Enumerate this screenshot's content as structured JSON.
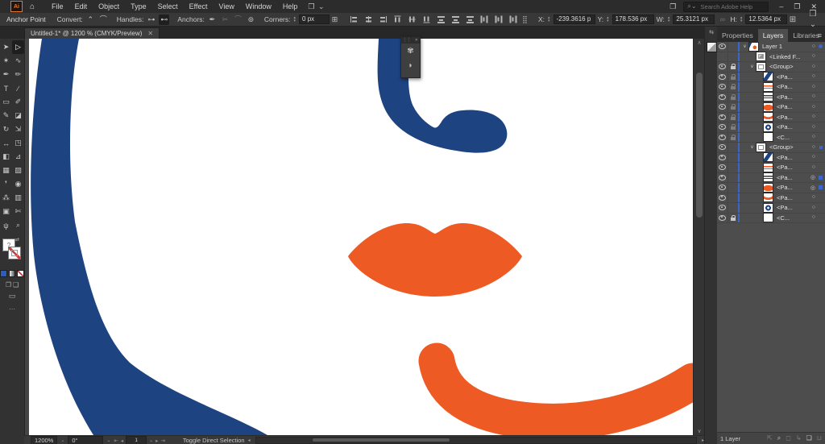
{
  "menubar": {
    "logo": "Ai",
    "items": [
      "File",
      "Edit",
      "Object",
      "Type",
      "Select",
      "Effect",
      "View",
      "Window",
      "Help"
    ],
    "search_placeholder": "Search Adobe Help",
    "window_controls": {
      "minimize": "–",
      "restore": "❐",
      "close": "✕"
    }
  },
  "control_bar": {
    "context_label": "Anchor Point",
    "convert_label": "Convert:",
    "convert_icons": [
      {
        "name": "convert-corner-icon",
        "glyph": "⌃"
      },
      {
        "name": "convert-smooth-icon",
        "glyph": "⌒"
      }
    ],
    "handles_label": "Handles:",
    "handles_icons": [
      {
        "name": "show-handles-icon",
        "glyph": "⊶"
      },
      {
        "name": "hide-handles-icon",
        "glyph": "⊷",
        "active": true
      }
    ],
    "anchors_label": "Anchors:",
    "anchors_icons": [
      {
        "name": "add-anchor-icon",
        "glyph": "✒"
      },
      {
        "name": "cut-path-icon",
        "glyph": "✂",
        "dim": true
      },
      {
        "name": "connect-anchors-icon",
        "glyph": "⌒",
        "dim": true
      },
      {
        "name": "global-edit-icon",
        "glyph": "⊚"
      }
    ],
    "corners_label": "Corners:",
    "corners_value": "0 px",
    "align_options_glyph": "⊞",
    "align_icons": [
      {
        "name": "horizontal-align-left-icon",
        "cls": "alL",
        "rot": false
      },
      {
        "name": "horizontal-align-center-icon",
        "cls": "alC",
        "rot": false
      },
      {
        "name": "horizontal-align-right-icon",
        "cls": "alR",
        "rot": false
      },
      {
        "name": "vertical-align-top-icon",
        "cls": "alL",
        "rot": true
      },
      {
        "name": "vertical-align-center-icon",
        "cls": "alC",
        "rot": true
      },
      {
        "name": "vertical-align-bottom-icon",
        "cls": "alR",
        "rot": true
      },
      {
        "name": "distribute-vertical-top-icon",
        "cls": "dst",
        "rot": false
      },
      {
        "name": "distribute-vertical-center-icon",
        "cls": "dst",
        "rot": false
      },
      {
        "name": "distribute-vertical-bottom-icon",
        "cls": "dst",
        "rot": false
      },
      {
        "name": "distribute-horizontal-left-icon",
        "cls": "dst",
        "rot": true
      },
      {
        "name": "distribute-horizontal-center-icon",
        "cls": "dst",
        "rot": true
      },
      {
        "name": "distribute-horizontal-right-icon",
        "cls": "dst",
        "rot": true
      }
    ],
    "align_to_glyph": "⣿",
    "x_label": "X:",
    "x_value": "-239.3616 p",
    "y_label": "Y:",
    "y_value": "178.536 px",
    "w_label": "W:",
    "w_value": "25.3121 px",
    "link_glyph": "∞",
    "h_label": "H:",
    "h_value": "12.5364 px",
    "right_icons": [
      {
        "name": "arrange-documents-icon",
        "glyph": "⊞"
      },
      {
        "name": "workspace-switcher-icon",
        "glyph": "❒ ⌄"
      },
      {
        "name": "control-panel-menu-icon",
        "glyph": "≔"
      }
    ]
  },
  "document_tab": {
    "title": "Untitled-1* @ 1200 % (CMYK/Preview)",
    "close": "✕"
  },
  "toolbar": {
    "fill_indicator": "?",
    "swap_glyph": "⇄",
    "draw_mode_glyphs": [
      "❐",
      "❑"
    ],
    "screen_mode_glyph": "▭",
    "more_glyph": "⋯",
    "tools": [
      {
        "name": "selection",
        "glyph": "➤"
      },
      {
        "name": "direct-selection",
        "glyph": "▷",
        "active": true
      },
      {
        "name": "magic-wand",
        "glyph": "✶"
      },
      {
        "name": "lasso",
        "glyph": "∿"
      },
      {
        "name": "pen",
        "glyph": "✒"
      },
      {
        "name": "curvature",
        "glyph": "✏"
      },
      {
        "name": "type",
        "glyph": "T"
      },
      {
        "name": "line-segment",
        "glyph": "∕"
      },
      {
        "name": "rectangle",
        "glyph": "▭"
      },
      {
        "name": "paintbrush",
        "glyph": "✐"
      },
      {
        "name": "pencil",
        "glyph": "✎"
      },
      {
        "name": "eraser",
        "glyph": "◪"
      },
      {
        "name": "rotate",
        "glyph": "↻"
      },
      {
        "name": "scale",
        "glyph": "⇲"
      },
      {
        "name": "width",
        "glyph": "↔"
      },
      {
        "name": "free-transform",
        "glyph": "◳"
      },
      {
        "name": "shape-builder",
        "glyph": "◧"
      },
      {
        "name": "perspective-grid",
        "glyph": "⊿"
      },
      {
        "name": "mesh",
        "glyph": "▦"
      },
      {
        "name": "gradient",
        "glyph": "▨"
      },
      {
        "name": "eyedropper",
        "glyph": "❜"
      },
      {
        "name": "blend",
        "glyph": "◉"
      },
      {
        "name": "symbol-sprayer",
        "glyph": "⁂"
      },
      {
        "name": "column-graph",
        "glyph": "▥"
      },
      {
        "name": "artboard",
        "glyph": "▣"
      },
      {
        "name": "slice",
        "glyph": "✄"
      },
      {
        "name": "hand",
        "glyph": "ψ"
      },
      {
        "name": "zoom",
        "glyph": "⌕"
      }
    ]
  },
  "canvas": {
    "colors": {
      "blue": "#1D4380",
      "orange": "#EE5A23",
      "white": "#FFFFFF"
    },
    "shapes": [
      "face-outline-curve",
      "nose-shape",
      "lips-shape",
      "chin-curve"
    ]
  },
  "float_widget": {
    "close": "✕",
    "drag": "⋮⋮",
    "icon1": "✾",
    "icon2": "◗"
  },
  "dock": {
    "expand_glyph": "⇆"
  },
  "panels": {
    "tabs": [
      "Properties",
      "Layers",
      "Libraries"
    ],
    "active_tab": "Layers",
    "menu_glyph": "≡",
    "layers": {
      "rows": [
        {
          "label": "Layer 1",
          "eye": true,
          "lock": null,
          "chevron": true,
          "indent": 0,
          "thumb": "layer1",
          "target": "circle",
          "chip": "dot"
        },
        {
          "label": "<Linked F...",
          "eye": false,
          "lock": null,
          "chevron": false,
          "indent": 1,
          "thumb": "linked",
          "target": "circle",
          "chip": null
        },
        {
          "label": "<Group>",
          "eye": true,
          "lock": "on",
          "chevron": true,
          "indent": 1,
          "thumb": "group",
          "target": "circle",
          "chip": null
        },
        {
          "label": "<Pa...",
          "eye": true,
          "lock": "dim",
          "chevron": false,
          "indent": 2,
          "thumb": "blue-diagonal",
          "target": "circle",
          "chip": null
        },
        {
          "label": "<Pa...",
          "eye": true,
          "lock": "dim",
          "chevron": false,
          "indent": 2,
          "thumb": "orange-lines",
          "target": "circle",
          "chip": null
        },
        {
          "label": "<Pa...",
          "eye": true,
          "lock": "dim",
          "chevron": false,
          "indent": 2,
          "thumb": "dark-lines",
          "target": "circle",
          "chip": null
        },
        {
          "label": "<Pa...",
          "eye": true,
          "lock": "dim",
          "chevron": false,
          "indent": 2,
          "thumb": "orange-blob",
          "target": "circle",
          "chip": null
        },
        {
          "label": "<Pa...",
          "eye": true,
          "lock": "dim",
          "chevron": false,
          "indent": 2,
          "thumb": "orange-curve",
          "target": "circle",
          "chip": null
        },
        {
          "label": "<Pa...",
          "eye": true,
          "lock": "dim",
          "chevron": false,
          "indent": 2,
          "thumb": "blue-swirl",
          "target": "circle",
          "chip": null
        },
        {
          "label": "<C...",
          "eye": true,
          "lock": "dim",
          "chevron": false,
          "indent": 2,
          "thumb": "white",
          "target": "circle",
          "chip": null
        },
        {
          "label": "<Group>",
          "eye": true,
          "lock": null,
          "chevron": true,
          "indent": 1,
          "thumb": "group",
          "target": "circle",
          "chip": "square-sm"
        },
        {
          "label": "<Pa...",
          "eye": true,
          "lock": null,
          "chevron": false,
          "indent": 2,
          "thumb": "blue-diagonal",
          "target": "circle",
          "chip": null
        },
        {
          "label": "<Pa...",
          "eye": true,
          "lock": null,
          "chevron": false,
          "indent": 2,
          "thumb": "orange-lines",
          "target": "circle",
          "chip": null
        },
        {
          "label": "<Pa...",
          "eye": true,
          "lock": null,
          "chevron": false,
          "indent": 2,
          "thumb": "dark-lines",
          "target": "double",
          "chip": "square"
        },
        {
          "label": "<Pa...",
          "eye": true,
          "lock": null,
          "chevron": false,
          "indent": 2,
          "thumb": "orange-blob",
          "target": "double",
          "chip": "square"
        },
        {
          "label": "<Pa...",
          "eye": true,
          "lock": null,
          "chevron": false,
          "indent": 2,
          "thumb": "orange-curve",
          "target": "circle",
          "chip": null
        },
        {
          "label": "<Pa...",
          "eye": true,
          "lock": null,
          "chevron": false,
          "indent": 2,
          "thumb": "blue-swirl",
          "target": "circle",
          "chip": null
        },
        {
          "label": "<C...",
          "eye": true,
          "lock": "on",
          "chevron": false,
          "indent": 2,
          "thumb": "white",
          "target": "circle",
          "chip": null
        }
      ],
      "footer_count": "1 Layer",
      "footer_icons": [
        {
          "name": "collect-for-export-icon",
          "glyph": "⇱",
          "dim": true
        },
        {
          "name": "locate-object-icon",
          "glyph": "⌕",
          "dim": false
        },
        {
          "name": "make-clipping-mask-icon",
          "glyph": "◻",
          "dim": true
        },
        {
          "name": "new-sublayer-icon",
          "glyph": "↳",
          "dim": true
        },
        {
          "name": "new-layer-icon",
          "glyph": "❏",
          "dim": false
        },
        {
          "name": "delete-selection-icon",
          "glyph": "⊔",
          "dim": true
        }
      ]
    }
  },
  "status_bar": {
    "zoom": "1200%",
    "rotation": "0°",
    "nav_first": "⇤",
    "nav_prev": "◂",
    "artboard": "1",
    "nav_next": "▸",
    "nav_last": "⇥",
    "message": "Toggle Direct Selection",
    "caret": "⌄"
  },
  "scrollbars": {
    "up": "∧",
    "down": "∨",
    "left": "◂",
    "right": "▸"
  }
}
